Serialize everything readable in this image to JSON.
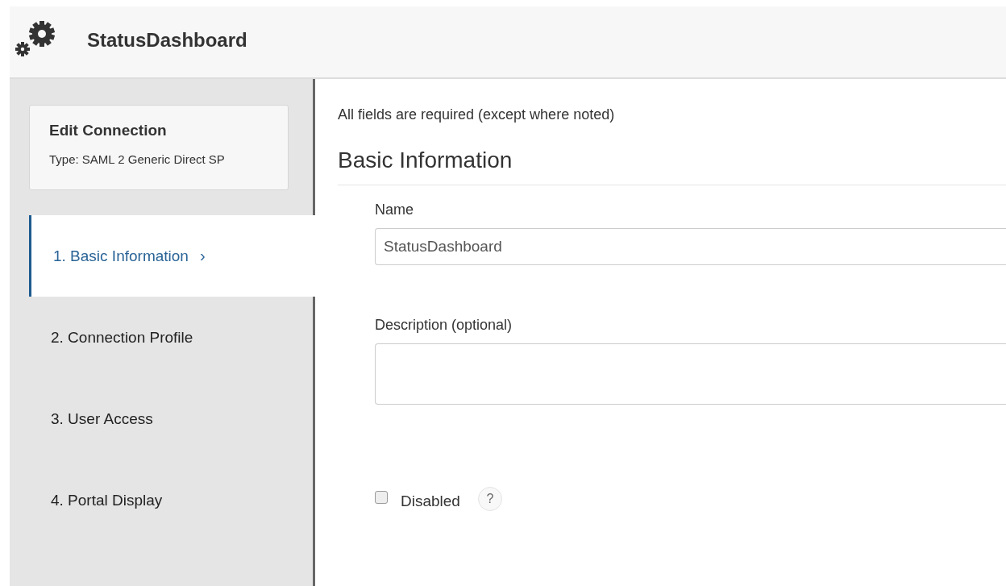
{
  "header": {
    "title": "StatusDashboard"
  },
  "sidebar": {
    "card": {
      "title": "Edit Connection",
      "subtitle": "Type: SAML 2 Generic Direct SP"
    },
    "steps": [
      {
        "label": "1. Basic Information",
        "selected": true,
        "chevron": "›"
      },
      {
        "label": "2. Connection Profile",
        "selected": false
      },
      {
        "label": "3. User Access",
        "selected": false
      },
      {
        "label": "4. Portal Display",
        "selected": false
      }
    ]
  },
  "content": {
    "note": "All fields are required (except where noted)",
    "section_title": "Basic Information",
    "fields": [
      {
        "kind": "input",
        "label": "Name",
        "value": "StatusDashboard"
      },
      {
        "kind": "textarea",
        "label": "Description (optional)"
      }
    ],
    "disabled_checkbox": {
      "label": "Disabled",
      "checked": false,
      "help": "?"
    }
  }
}
